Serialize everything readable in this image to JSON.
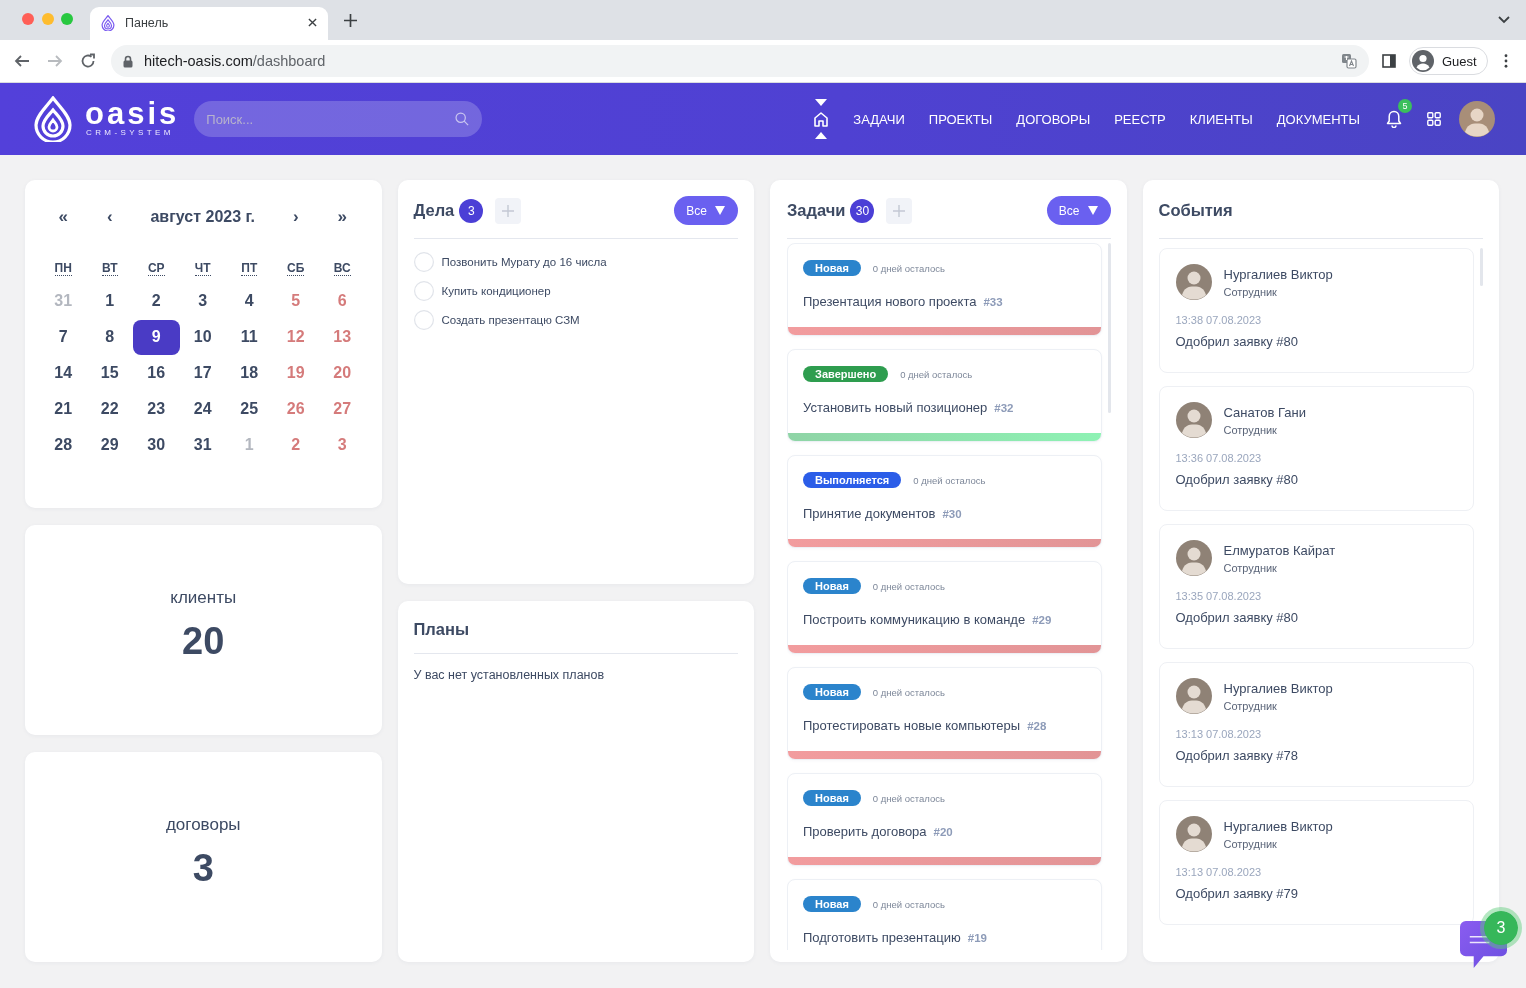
{
  "browser": {
    "tab": {
      "title": "Панель"
    },
    "controls": [
      {
        "kind": "back",
        "disabled": false
      },
      {
        "kind": "forward",
        "disabled": true
      },
      {
        "kind": "reload",
        "disabled": false
      }
    ],
    "address": {
      "host": "hitech-oasis.com",
      "path": "/dashboard"
    },
    "profile": "Guest"
  },
  "header": {
    "logo": {
      "wordmark": "oasis",
      "tagline": "CRM-SYSTEM"
    },
    "search": {
      "placeholder": "Поиск..."
    },
    "nav": [
      {
        "kind": "home",
        "selected": true
      },
      {
        "kind": "link",
        "label": "ЗАДАЧИ",
        "selected": false
      },
      {
        "kind": "link",
        "label": "ПРОЕКТЫ",
        "selected": false
      },
      {
        "kind": "link",
        "label": "ДОГОВОРЫ",
        "selected": false
      },
      {
        "kind": "link",
        "label": "РЕЕСТР",
        "selected": false
      },
      {
        "kind": "link",
        "label": "КЛИЕНТЫ",
        "selected": false
      },
      {
        "kind": "link",
        "label": "ДОКУМЕНТЫ",
        "selected": false
      }
    ],
    "notifications": "5"
  },
  "calendar": {
    "prev_year": "«",
    "prev_month": "‹",
    "title": "август 2023 г.",
    "next_month": "›",
    "next_year": "»",
    "weekdays": [
      "ПН",
      "ВТ",
      "СР",
      "ЧТ",
      "ПТ",
      "СБ",
      "ВС"
    ],
    "weeks": [
      [
        {
          "day": "31",
          "kind": "muted",
          "selected": false
        },
        {
          "day": "1",
          "kind": "weekday",
          "selected": false
        },
        {
          "day": "2",
          "kind": "weekday",
          "selected": false
        },
        {
          "day": "3",
          "kind": "weekday",
          "selected": false
        },
        {
          "day": "4",
          "kind": "weekday",
          "selected": false
        },
        {
          "day": "5",
          "kind": "weekend",
          "selected": false
        },
        {
          "day": "6",
          "kind": "weekend",
          "selected": false
        }
      ],
      [
        {
          "day": "7",
          "kind": "weekday",
          "selected": false
        },
        {
          "day": "8",
          "kind": "weekday",
          "selected": false
        },
        {
          "day": "9",
          "kind": "weekday",
          "selected": true
        },
        {
          "day": "10",
          "kind": "weekday",
          "selected": false
        },
        {
          "day": "11",
          "kind": "weekday",
          "selected": false
        },
        {
          "day": "12",
          "kind": "weekend",
          "selected": false
        },
        {
          "day": "13",
          "kind": "weekend",
          "selected": false
        }
      ],
      [
        {
          "day": "14",
          "kind": "weekday",
          "selected": false
        },
        {
          "day": "15",
          "kind": "weekday",
          "selected": false
        },
        {
          "day": "16",
          "kind": "weekday",
          "selected": false
        },
        {
          "day": "17",
          "kind": "weekday",
          "selected": false
        },
        {
          "day": "18",
          "kind": "weekday",
          "selected": false
        },
        {
          "day": "19",
          "kind": "weekend",
          "selected": false
        },
        {
          "day": "20",
          "kind": "weekend",
          "selected": false
        }
      ],
      [
        {
          "day": "21",
          "kind": "weekday",
          "selected": false
        },
        {
          "day": "22",
          "kind": "weekday",
          "selected": false
        },
        {
          "day": "23",
          "kind": "weekday",
          "selected": false
        },
        {
          "day": "24",
          "kind": "weekday",
          "selected": false
        },
        {
          "day": "25",
          "kind": "weekday",
          "selected": false
        },
        {
          "day": "26",
          "kind": "weekend",
          "selected": false
        },
        {
          "day": "27",
          "kind": "weekend",
          "selected": false
        }
      ],
      [
        {
          "day": "28",
          "kind": "weekday",
          "selected": false
        },
        {
          "day": "29",
          "kind": "weekday",
          "selected": false
        },
        {
          "day": "30",
          "kind": "weekday",
          "selected": false
        },
        {
          "day": "31",
          "kind": "weekday",
          "selected": false
        },
        {
          "day": "1",
          "kind": "muted",
          "selected": false
        },
        {
          "day": "2",
          "kind": "weekend",
          "selected": false
        },
        {
          "day": "3",
          "kind": "weekend",
          "selected": false
        }
      ]
    ]
  },
  "stats": [
    {
      "label": "клиенты",
      "value": "20"
    },
    {
      "label": "договоры",
      "value": "3"
    }
  ],
  "todos": {
    "title": "Дела",
    "count": "3",
    "filter": "Все",
    "items": [
      {
        "text": "Позвонить Мурату до 16 числа",
        "checked": false
      },
      {
        "text": "Купить кондиционер",
        "checked": false
      },
      {
        "text": "Создать презентацю СЗМ",
        "checked": false
      }
    ]
  },
  "plans": {
    "title": "Планы",
    "empty": "У вас нет установленных планов"
  },
  "tasks": {
    "title": "Задачи",
    "count": "30",
    "filter": "Все",
    "items": [
      {
        "status": "Новая",
        "kind": "new",
        "remaining": "0 дней осталось",
        "title": "Презентация нового проекта",
        "number": "#33"
      },
      {
        "status": "Завершено",
        "kind": "done",
        "remaining": "0 дней осталось",
        "title": "Установить новый позиционер",
        "number": "#32"
      },
      {
        "status": "Выполняется",
        "kind": "in_progress",
        "remaining": "0 дней осталось",
        "title": "Принятие документов",
        "number": "#30"
      },
      {
        "status": "Новая",
        "kind": "new",
        "remaining": "0 дней осталось",
        "title": "Построить коммуникацию в команде",
        "number": "#29"
      },
      {
        "status": "Новая",
        "kind": "new",
        "remaining": "0 дней осталось",
        "title": "Протестировать новые компьютеры",
        "number": "#28"
      },
      {
        "status": "Новая",
        "kind": "new",
        "remaining": "0 дней осталось",
        "title": "Проверить договора",
        "number": "#20"
      },
      {
        "status": "Новая",
        "kind": "new",
        "remaining": "0 дней осталось",
        "title": "Подготовить презентацию",
        "number": "#19"
      }
    ]
  },
  "events": {
    "title": "События",
    "items": [
      {
        "name": "Нургалиев Виктор",
        "role": "Сотрудник",
        "time": "13:38 07.08.2023",
        "action": "Одобрил заявку #80"
      },
      {
        "name": "Санатов Гани",
        "role": "Сотрудник",
        "time": "13:36 07.08.2023",
        "action": "Одобрил заявку #80"
      },
      {
        "name": "Елмуратов Кайрат",
        "role": "Сотрудник",
        "time": "13:35 07.08.2023",
        "action": "Одобрил заявку #80"
      },
      {
        "name": "Нургалиев Виктор",
        "role": "Сотрудник",
        "time": "13:13 07.08.2023",
        "action": "Одобрил заявку #78"
      },
      {
        "name": "Нургалиев Виктор",
        "role": "Сотрудник",
        "time": "13:13 07.08.2023",
        "action": "Одобрил заявку #79"
      }
    ]
  },
  "chat": {
    "unread": "3"
  }
}
